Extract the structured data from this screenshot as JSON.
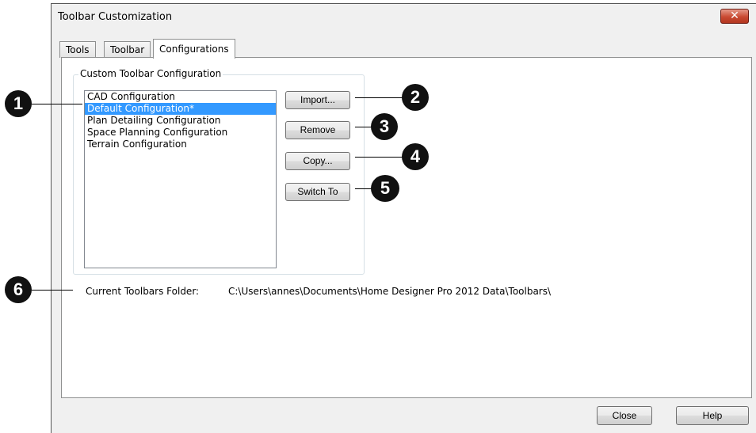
{
  "window": {
    "title": "Toolbar Customization",
    "close_glyph": "✕"
  },
  "tabs": [
    {
      "label": "Tools"
    },
    {
      "label": "Toolbar"
    },
    {
      "label": "Configurations"
    }
  ],
  "group": {
    "title": "Custom Toolbar Configuration",
    "items": [
      "CAD Configuration",
      "Default Configuration*",
      "Plan Detailing Configuration",
      "Space Planning Configuration",
      "Terrain Configuration"
    ],
    "selected_index": 1
  },
  "buttons": {
    "import": "Import...",
    "remove": "Remove",
    "copy": "Copy...",
    "switch_to": "Switch To",
    "close": "Close",
    "help": "Help"
  },
  "folder": {
    "label": "Current Toolbars Folder:",
    "path": "C:\\Users\\annes\\Documents\\Home Designer Pro 2012 Data\\Toolbars\\"
  },
  "callouts": [
    "1",
    "2",
    "3",
    "4",
    "5",
    "6"
  ],
  "colors": {
    "selection": "#3399ff",
    "close_button": "#c94a32"
  }
}
